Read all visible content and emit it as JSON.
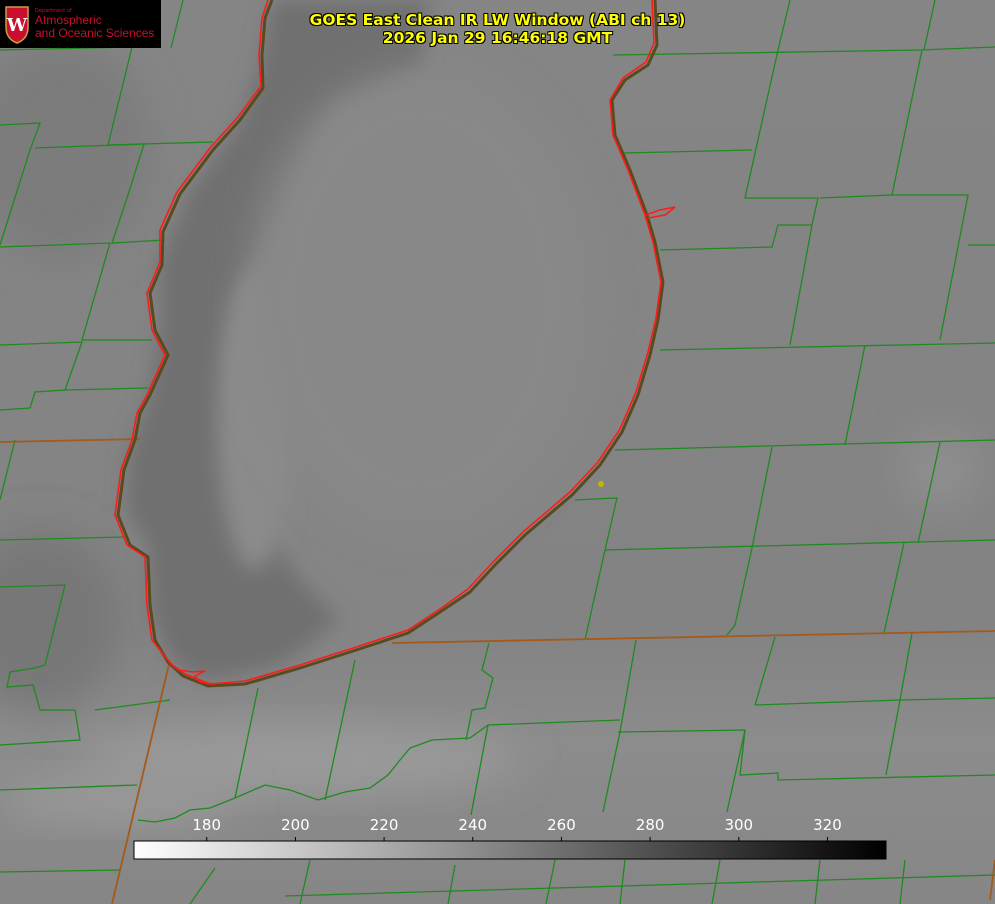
{
  "title": {
    "line1": "GOES East Clean IR LW Window (ABI ch 13)",
    "line2": "2026 Jan 29 16:46:18 GMT"
  },
  "logo": {
    "department": "Department of",
    "line1": "Atmospheric",
    "line2": "and Oceanic Sciences",
    "icon": "uw-crest-icon"
  },
  "colorbar": {
    "ticks": [
      "180",
      "200",
      "220",
      "240",
      "260",
      "280",
      "300",
      "320"
    ],
    "tick_values": [
      180,
      200,
      220,
      240,
      260,
      280,
      300,
      320
    ],
    "range": [
      163.6,
      333.2
    ],
    "direction": "white-to-black"
  },
  "colors": {
    "title": "#ffff00",
    "county_lines": "#1f8a1f",
    "state_lines": "#a35a1a",
    "coastline": "#ff0000",
    "marker": "#c8b400"
  }
}
